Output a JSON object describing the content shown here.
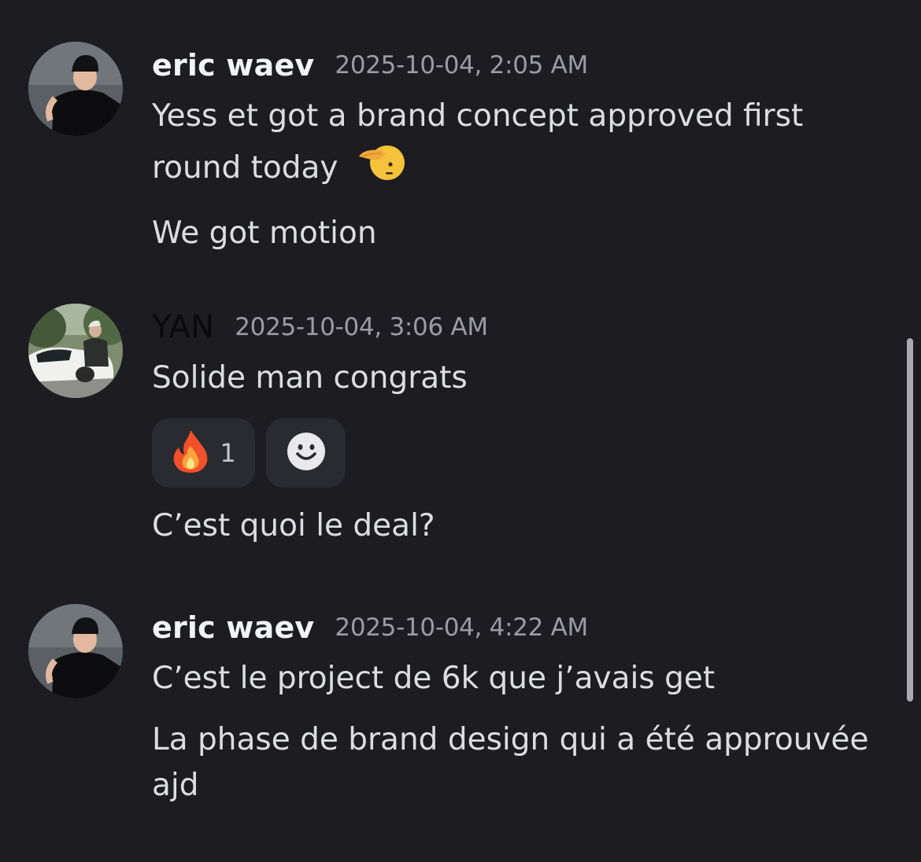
{
  "messages": [
    {
      "author": "eric waev",
      "timestamp": "2025-10-04, 2:05 AM",
      "avatar_icon": "person-beanie-avatar",
      "lines": [
        {
          "text": "Yess et got a brand concept approved first"
        },
        {
          "text": "round today",
          "emoji": "saluting-face-emoji"
        },
        {
          "text": "We got motion"
        }
      ]
    },
    {
      "author": "YAN",
      "timestamp": "2025-10-04, 3:06 AM",
      "avatar_icon": "person-with-car-avatar",
      "lines": [
        {
          "text": "Solide man congrats"
        }
      ],
      "reactions": [
        {
          "emoji": "fire-emoji",
          "count": "1"
        },
        {
          "emoji": "add-reaction-icon"
        }
      ],
      "after_lines": [
        {
          "text": "C’est quoi le deal?"
        }
      ]
    },
    {
      "author": "eric waev",
      "timestamp": "2025-10-04, 4:22 AM",
      "avatar_icon": "person-beanie-avatar",
      "lines": [
        {
          "text": "C’est le project de 6k que j’avais get"
        },
        {
          "text": "La phase de brand design qui a été approuvée"
        },
        {
          "text": "ajd"
        }
      ]
    }
  ],
  "colors": {
    "background": "#1c1c21",
    "username": "#f2f3f5",
    "timestamp": "#9b9ca3",
    "text": "#dcdde1",
    "reaction_bg": "#2a2b31"
  }
}
